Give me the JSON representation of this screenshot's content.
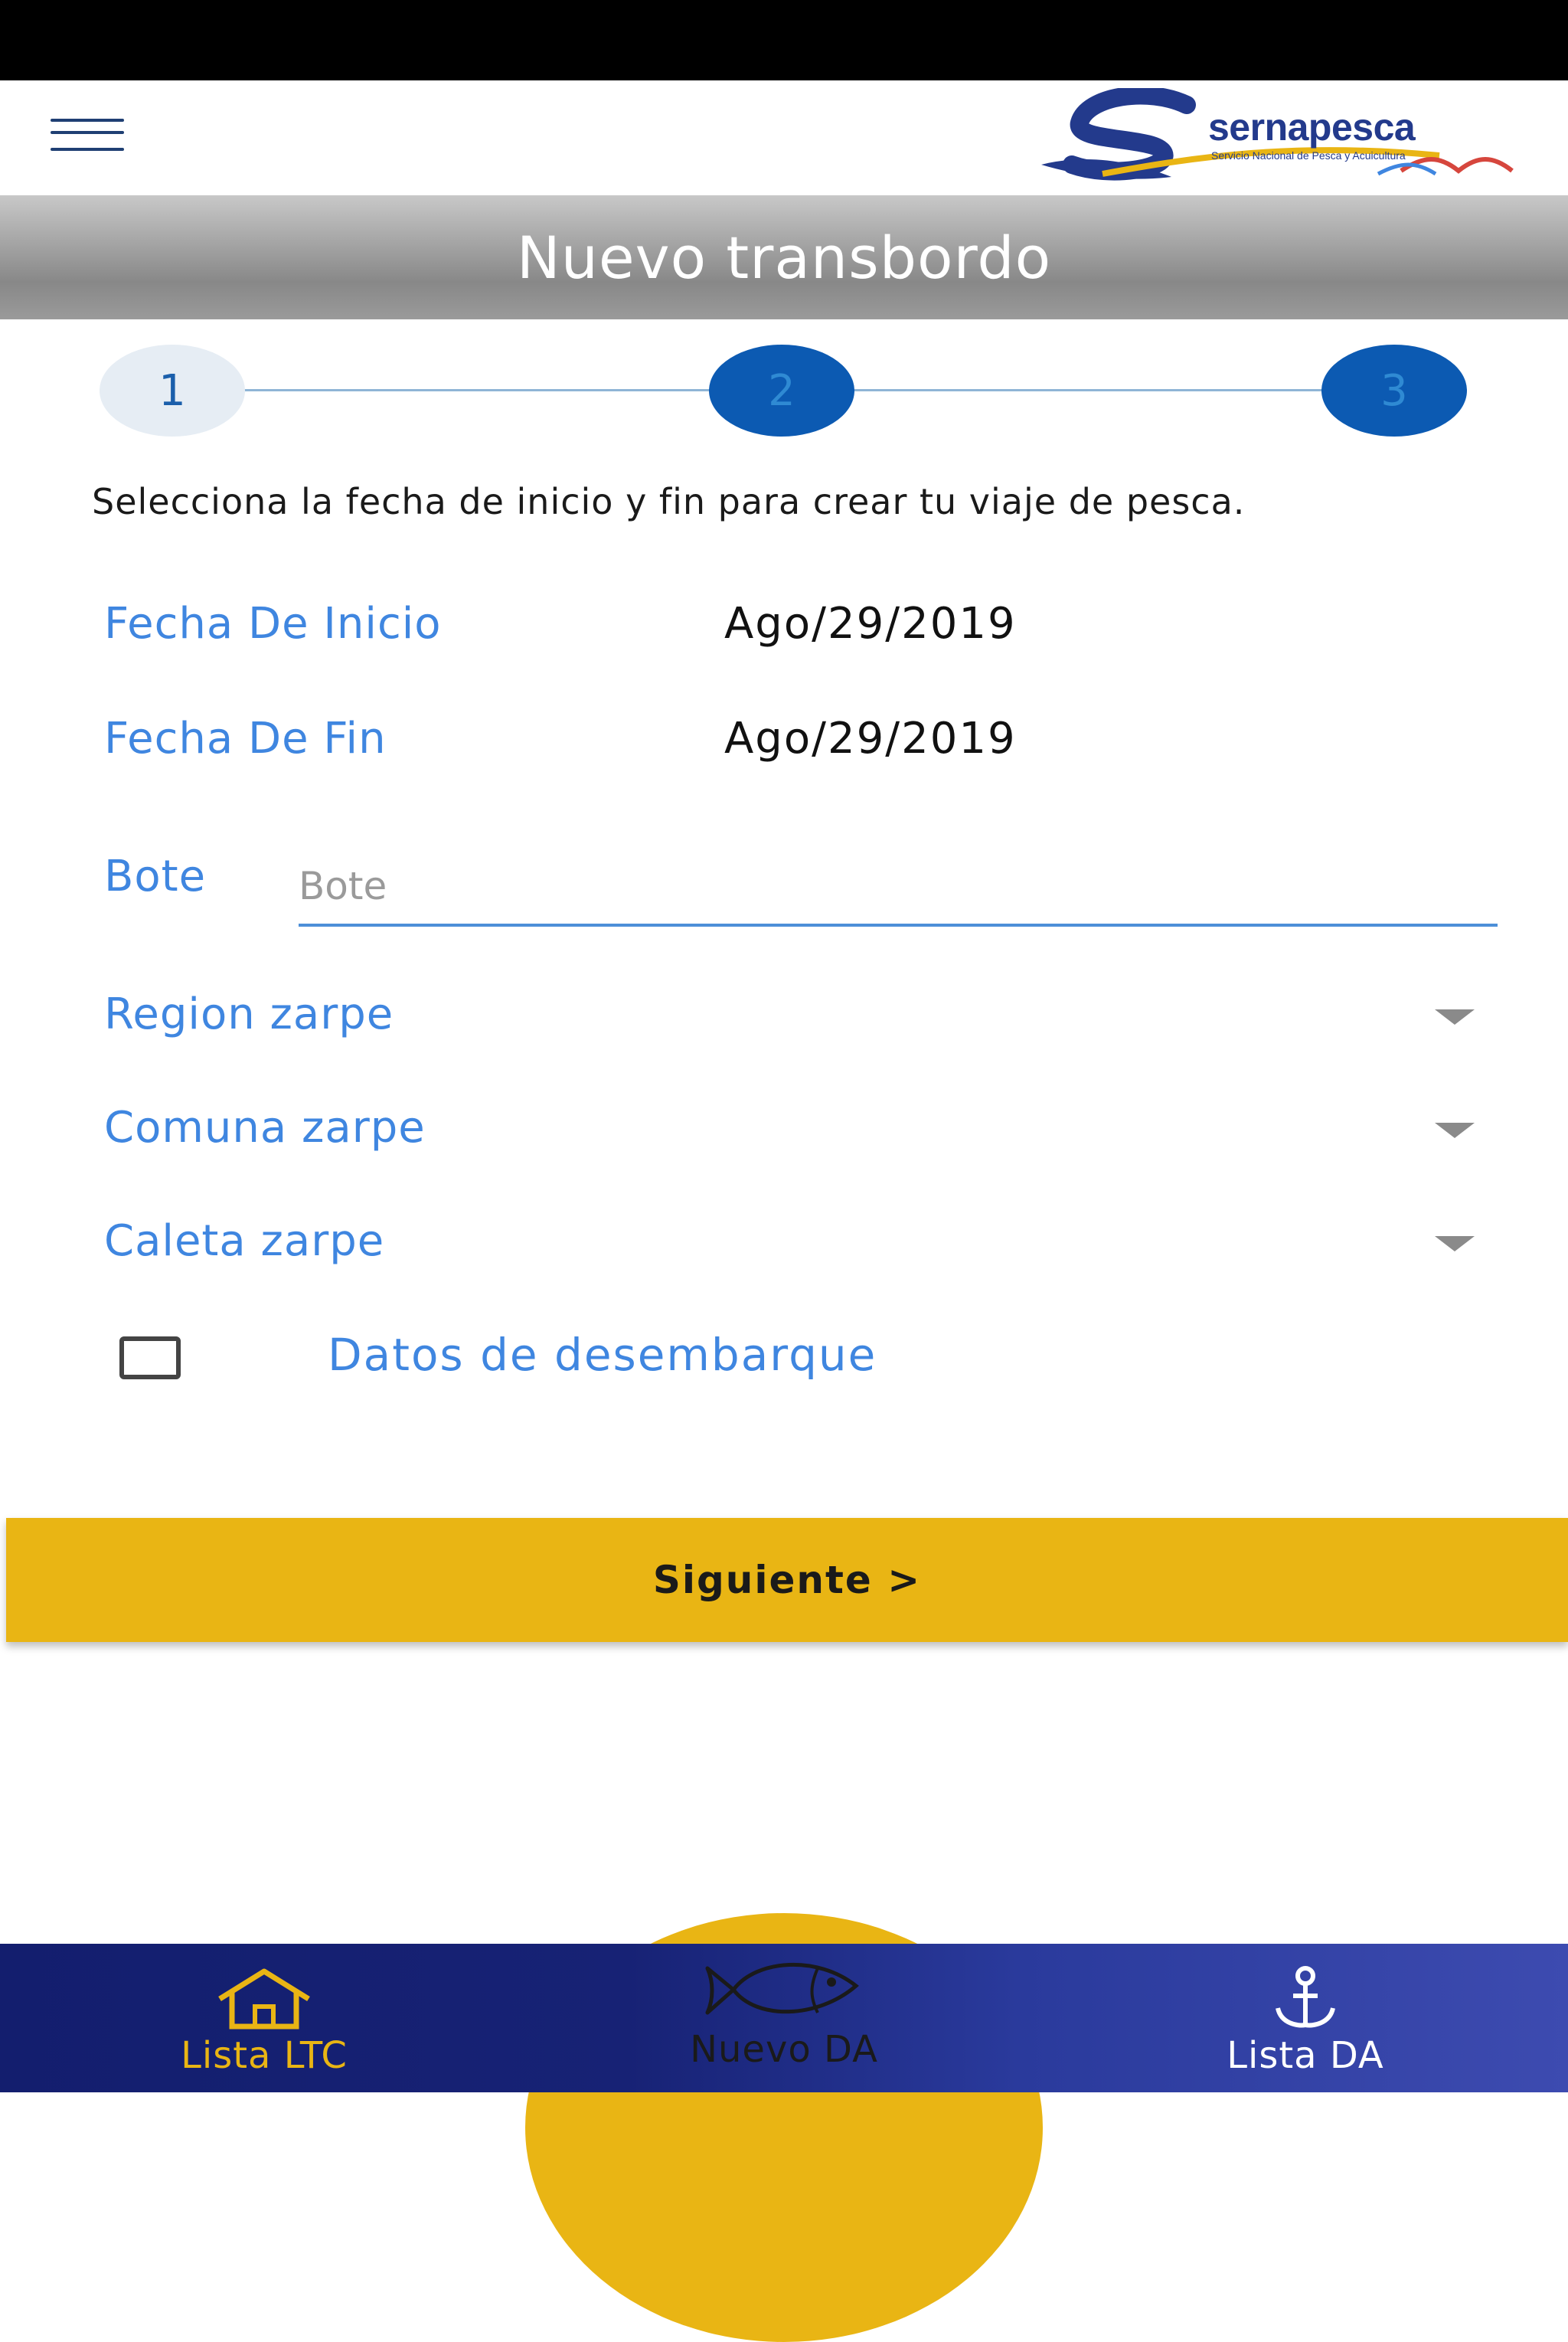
{
  "header": {
    "logo_text": "sernapesca",
    "logo_subtitle": "Servicio Nacional de Pesca y Acuicultura"
  },
  "page": {
    "title": "Nuevo transbordo"
  },
  "stepper": {
    "steps": [
      "1",
      "2",
      "3"
    ],
    "current_step": 1
  },
  "form": {
    "instructions": "Selecciona la fecha de inicio y fin para crear tu viaje de pesca.",
    "start_date_label": "Fecha De Inicio",
    "start_date_value": "Ago/29/2019",
    "end_date_label": "Fecha De Fin",
    "end_date_value": "Ago/29/2019",
    "boat_label": "Bote",
    "boat_placeholder": "Bote",
    "boat_value": "",
    "region_label": "Region zarpe",
    "comuna_label": "Comuna zarpe",
    "caleta_label": "Caleta zarpe",
    "landing_data_label": "Datos de desembarque",
    "landing_data_checked": false,
    "next_label": "Siguiente >"
  },
  "bottom_nav": {
    "items": [
      {
        "label": "Lista LTC",
        "icon": "home-icon"
      },
      {
        "label": "Nuevo DA",
        "icon": "fish-icon"
      },
      {
        "label": "Lista DA",
        "icon": "anchor-icon"
      }
    ]
  },
  "colors": {
    "accent_blue": "#3f86e0",
    "step_dark": "#0c5ab2",
    "button_yellow": "#e9b514",
    "nav_dark": "#131e6e"
  }
}
